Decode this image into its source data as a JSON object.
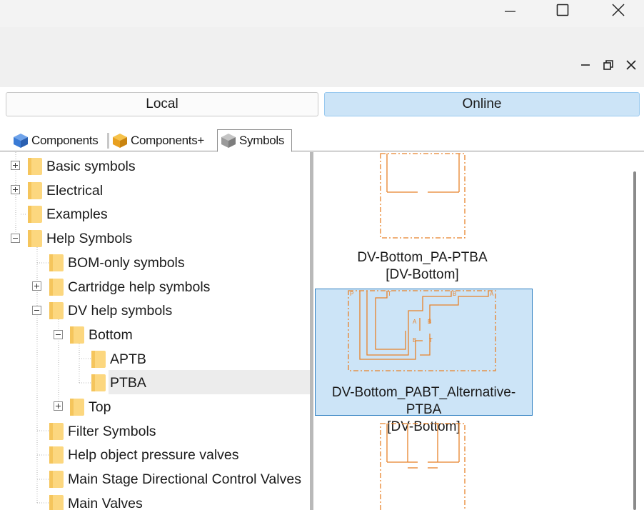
{
  "window": {
    "minimize_icon": "minimize-icon",
    "maximize_icon": "maximize-icon",
    "close_icon": "close-icon"
  },
  "subwindow": {
    "minimize_icon": "minimize-icon",
    "restore_icon": "restore-icon",
    "close_icon": "close-icon"
  },
  "source_toggle": {
    "local": "Local",
    "online": "Online",
    "selected": "Online"
  },
  "tabs": [
    {
      "label": "Components",
      "icon": "blue-cube-icon",
      "color": "#3a7bd5"
    },
    {
      "label": "Components+",
      "icon": "orange-cube-icon",
      "color": "#e8a020"
    },
    {
      "label": "Symbols",
      "icon": "grey-cube-icon",
      "color": "#9a9a9a",
      "active": true
    }
  ],
  "tree": [
    {
      "label": "Basic symbols",
      "expander": "plus"
    },
    {
      "label": "Electrical",
      "expander": "plus"
    },
    {
      "label": "Examples"
    },
    {
      "label": "Help Symbols",
      "expander": "minus"
    },
    {
      "label": "BOM-only symbols"
    },
    {
      "label": "Cartridge help symbols",
      "expander": "plus"
    },
    {
      "label": "DV help symbols",
      "expander": "minus"
    },
    {
      "label": "Bottom",
      "expander": "minus"
    },
    {
      "label": "APTB"
    },
    {
      "label": "PTBA",
      "selected": true
    },
    {
      "label": "Top",
      "expander": "plus"
    },
    {
      "label": "Filter Symbols"
    },
    {
      "label": "Help object pressure valves"
    },
    {
      "label": "Main Stage Directional Control Valves"
    },
    {
      "label": "Main Valves"
    }
  ],
  "symbols": [
    {
      "name": "DV-Bottom_PA-PTBA",
      "category": "[DV-Bottom]"
    },
    {
      "name": "DV-Bottom_PABT_Alternative-PTBA",
      "category": "[DV-Bottom]",
      "selected": true,
      "port_labels": [
        "P",
        "T",
        "B",
        "A",
        "A",
        "B",
        "B",
        "T"
      ]
    },
    {
      "name": "",
      "category": ""
    }
  ],
  "colors": {
    "accent": "#cce4f7",
    "accent_border": "#2d7ec1",
    "symbol_orange": "#e8822a",
    "folder": "#fcd77f"
  }
}
